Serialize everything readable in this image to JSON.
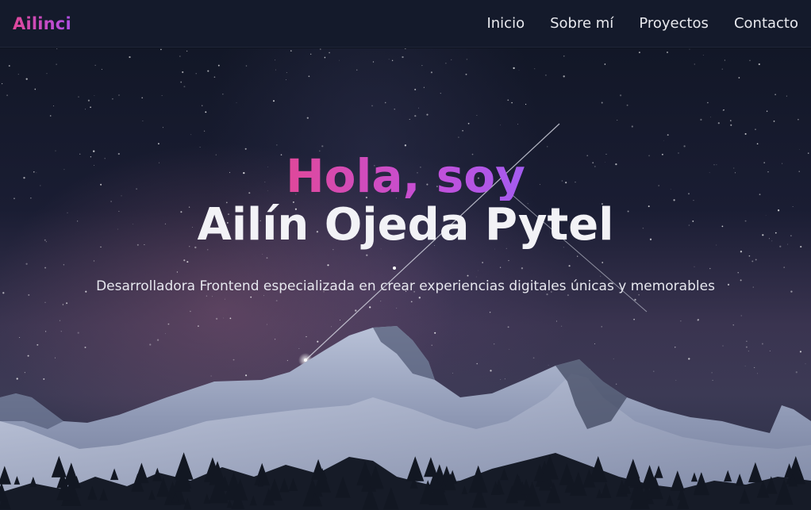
{
  "header": {
    "brand": "Ailinci",
    "nav": [
      "Inicio",
      "Sobre mí",
      "Proyectos",
      "Contacto"
    ]
  },
  "hero": {
    "greeting": "Hola, soy",
    "name": "Ailín Ojeda Pytel",
    "tagline": "Desarrolladora Frontend especializada en crear experiencias digitales únicas y memorables",
    "background_image": "starry-night-snowy-mountains"
  },
  "colors": {
    "accent_pink": "#e0489a",
    "accent_purple": "#a35cf0",
    "header_bg": "#141a2b"
  }
}
